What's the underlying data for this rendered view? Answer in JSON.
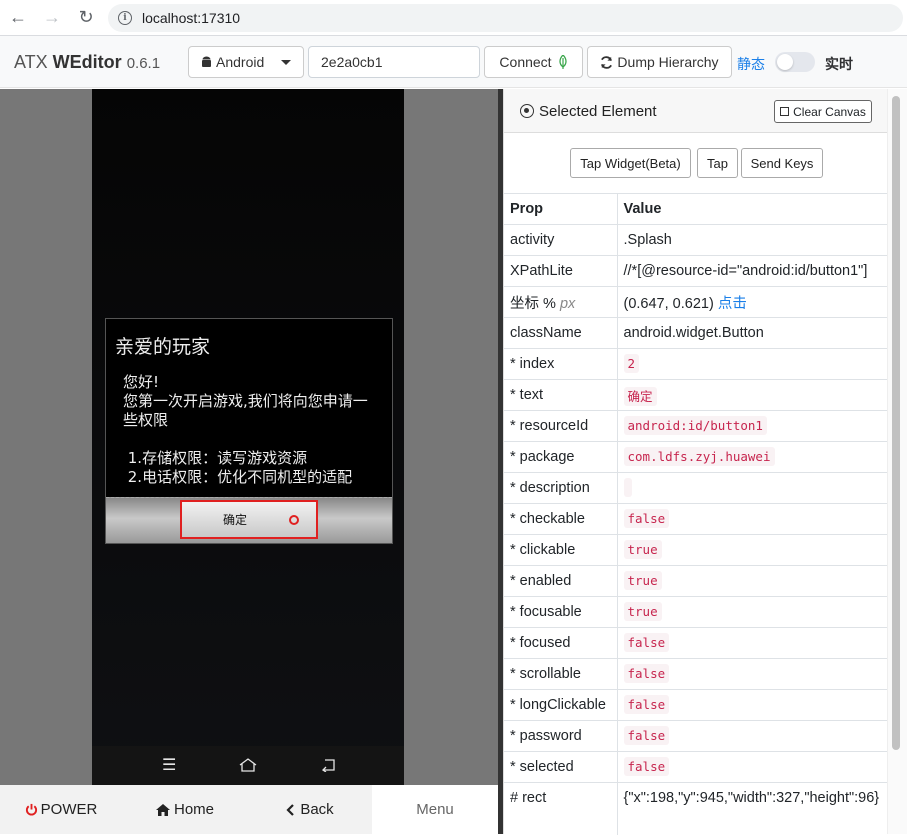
{
  "browser": {
    "url": "localhost:17310",
    "back": "←",
    "forward": "→",
    "reload": "↻"
  },
  "toolbar": {
    "brand_prefix": "ATX ",
    "brand_name": "WEditor",
    "version": "0.6.1",
    "platform": "Android",
    "device_id": "2e2a0cb1",
    "connect_label": "Connect",
    "dump_label": "Dump Hierarchy",
    "static_label": "静态",
    "realtime_label": "实时"
  },
  "device": {
    "dialog_title": "亲爱的玩家",
    "dialog_lines": [
      "您好!",
      "您第一次开启游戏,我们将向您申请一",
      "些权限",
      "",
      " 1.存储权限：读写游戏资源",
      " 2.电话权限：优化不同机型的适配"
    ],
    "ok_label": "确定"
  },
  "bottom": {
    "power": "POWER",
    "home": "Home",
    "back": "Back",
    "menu": "Menu"
  },
  "panel": {
    "title": "Selected Element",
    "clear_label": "Clear Canvas",
    "tap_widget": "Tap Widget(Beta)",
    "tap": "Tap",
    "send_keys": "Send Keys",
    "col_prop": "Prop",
    "col_value": "Value",
    "rows": [
      {
        "prop": "activity",
        "value": ".Splash",
        "code": false
      },
      {
        "prop": "XPathLite",
        "value": "//*[@resource-id=\"android:id/button1\"]",
        "code": false
      },
      {
        "prop": "坐标 %",
        "prop_suffix": "px",
        "value": "(0.647, 0.621)",
        "link": "点击",
        "code": false
      },
      {
        "prop": "className",
        "value": "android.widget.Button",
        "code": false
      },
      {
        "prop": "* index",
        "value": "2",
        "code": true
      },
      {
        "prop": "* text",
        "value": "确定",
        "code": true
      },
      {
        "prop": "* resourceId",
        "value": "android:id/button1",
        "code": true
      },
      {
        "prop": "* package",
        "value": "com.ldfs.zyj.huawei",
        "code": true
      },
      {
        "prop": "* description",
        "value": "",
        "code": true
      },
      {
        "prop": "* checkable",
        "value": "false",
        "code": true
      },
      {
        "prop": "* clickable",
        "value": "true",
        "code": true
      },
      {
        "prop": "* enabled",
        "value": "true",
        "code": true
      },
      {
        "prop": "* focusable",
        "value": "true",
        "code": true
      },
      {
        "prop": "* focused",
        "value": "false",
        "code": true
      },
      {
        "prop": "* scrollable",
        "value": "false",
        "code": true
      },
      {
        "prop": "* longClickable",
        "value": "false",
        "code": true
      },
      {
        "prop": "* password",
        "value": "false",
        "code": true
      },
      {
        "prop": "* selected",
        "value": "false",
        "code": true
      },
      {
        "prop": "# rect",
        "value": "{\"x\":198,\"y\":945,\"width\":327,\"height\":96}",
        "code": false
      }
    ]
  },
  "colors": {
    "accent_blue": "#1a7fe8",
    "highlight_red": "#e02020",
    "code_pink": "#c7254e"
  }
}
